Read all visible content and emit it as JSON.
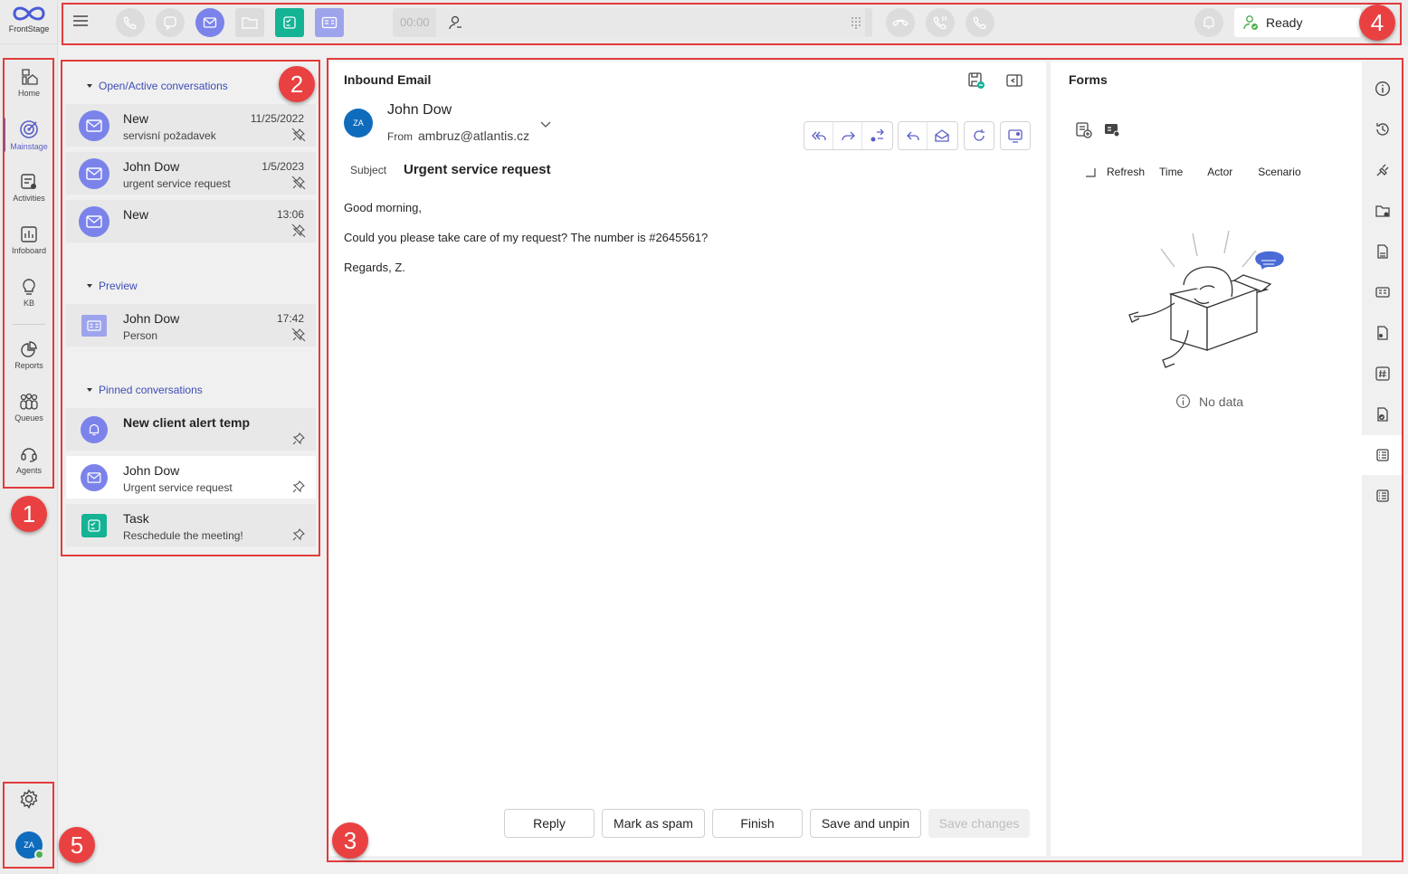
{
  "app": {
    "logo_text": "FrontStage"
  },
  "nav": {
    "items": [
      {
        "label": "Home",
        "icon": "home-icon"
      },
      {
        "label": "Mainstage",
        "icon": "target-icon",
        "active": true
      },
      {
        "label": "Activities",
        "icon": "activities-icon"
      },
      {
        "label": "Infoboard",
        "icon": "chart-icon"
      },
      {
        "label": "KB",
        "icon": "lightbulb-icon"
      },
      {
        "label": "Reports",
        "icon": "pie-icon"
      },
      {
        "label": "Queues",
        "icon": "people-icon"
      },
      {
        "label": "Agents",
        "icon": "headset-icon"
      }
    ]
  },
  "topbar": {
    "timer": "00:00",
    "status": "Ready"
  },
  "sections": {
    "open": "Open/Active conversations",
    "preview": "Preview",
    "pinned": "Pinned conversations"
  },
  "open_conversations": [
    {
      "title": "New",
      "subtitle": "servisní požadavek",
      "date": "11/25/2022"
    },
    {
      "title": "John Dow",
      "subtitle": "urgent service request",
      "date": "1/5/2023"
    },
    {
      "title": "New",
      "subtitle": "",
      "date": "13:06"
    }
  ],
  "preview": [
    {
      "title": "John Dow",
      "subtitle": "Person",
      "date": "17:42"
    }
  ],
  "pinned": [
    {
      "title": "New client alert temp",
      "subtitle": ""
    },
    {
      "title": "John Dow",
      "subtitle": "Urgent service request"
    },
    {
      "title": "Task",
      "subtitle": "Reschedule the meeting!"
    }
  ],
  "email": {
    "header": "Inbound Email",
    "sender_initials": "ZA",
    "sender_name": "John Dow",
    "from_label": "From",
    "from_address": "ambruz@atlantis.cz",
    "subject_label": "Subject",
    "subject": "Urgent service request",
    "body": [
      "Good morning,",
      "Could you please take care of my request? The number is #2645561?",
      "Regards, Z."
    ]
  },
  "footer_buttons": {
    "reply": "Reply",
    "spam": "Mark as spam",
    "finish": "Finish",
    "save_unpin": "Save and unpin",
    "save_changes": "Save changes"
  },
  "forms": {
    "title": "Forms",
    "columns": [
      "Refresh",
      "Time",
      "Actor",
      "Scenario"
    ],
    "empty": "No data"
  },
  "user": {
    "initials": "ZA"
  },
  "callouts": [
    "1",
    "2",
    "3",
    "4",
    "5"
  ],
  "colors": {
    "accent": "#5b5fc7",
    "avatar": "#0f6cbd",
    "task": "#13b394",
    "callout": "#e94141",
    "ready": "#4caf50"
  }
}
